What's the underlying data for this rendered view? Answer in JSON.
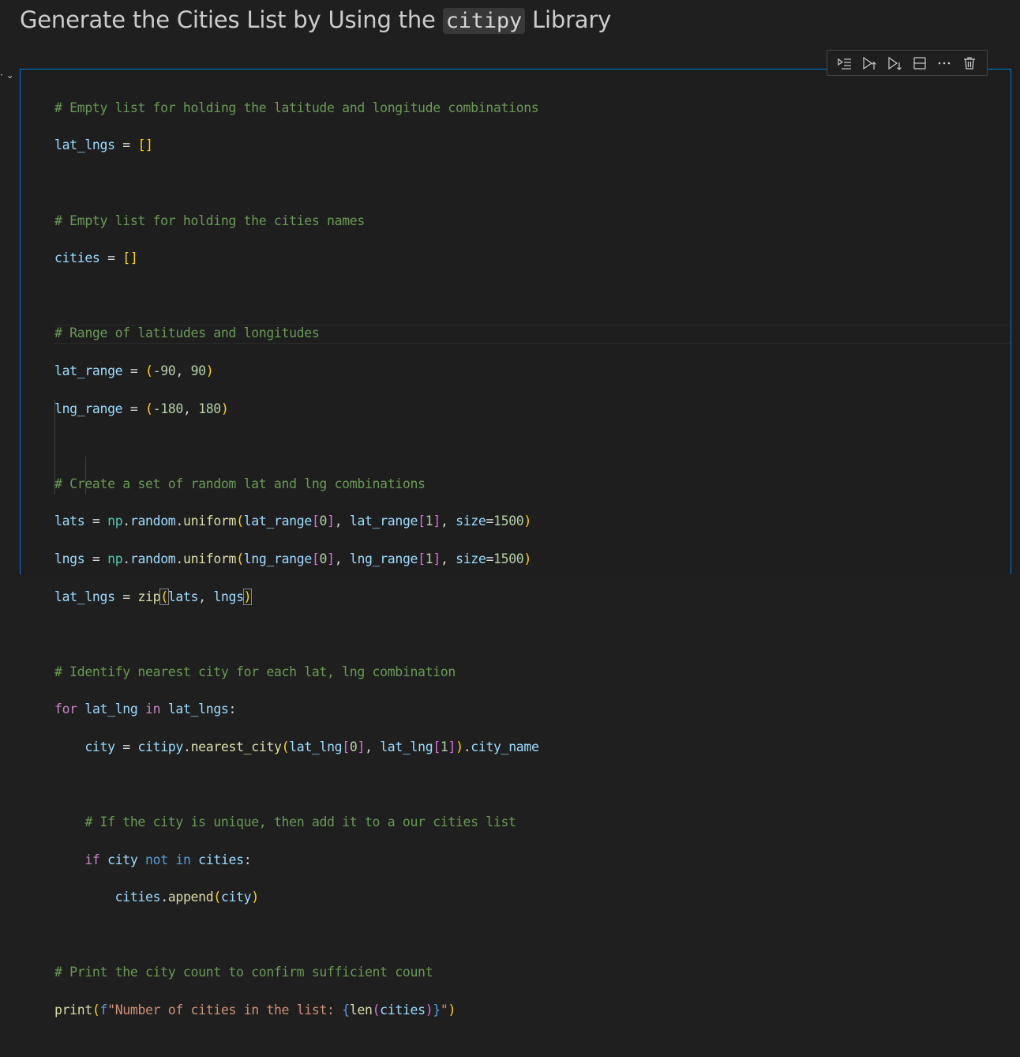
{
  "heading": {
    "prefix": "Generate the Cities List by Using the ",
    "code": "citipy",
    "suffix": " Library"
  },
  "toolbar": {
    "icons": [
      "run-by-line-icon",
      "run-above-icon",
      "run-below-icon",
      "split-cell-icon",
      "more-actions-icon",
      "delete-cell-icon"
    ]
  },
  "code": {
    "c1": "# Empty list for holding the latitude and longitude combinations",
    "c2": "# Empty list for holding the cities names",
    "c3": "# Range of latitudes and longitudes",
    "c4": "# Create a set of random lat and lng combinations",
    "c5": "# Identify nearest city for each lat, lng combination",
    "c6": "# If the city is unique, then add it to a our cities list",
    "c7": "# Print the city count to confirm sufficient count",
    "v_lat_lngs": "lat_lngs",
    "v_cities": "cities",
    "v_lat_range": "lat_range",
    "v_lng_range": "lng_range",
    "v_lats": "lats",
    "v_lngs": "lngs",
    "v_lat_lng": "lat_lng",
    "v_city": "city",
    "v_city_name": "city_name",
    "v_size": "size",
    "m_np": "np",
    "m_citipy": "citipy",
    "a_random": "random",
    "f_uniform": "uniform",
    "f_zip": "zip",
    "f_nearest_city": "nearest_city",
    "f_append": "append",
    "f_print": "print",
    "f_len": "len",
    "k_for": "for",
    "k_in": "in",
    "k_if": "if",
    "k_not": "not",
    "n_m90": "-90",
    "n_90": "90",
    "n_m180": "-180",
    "n_180": "180",
    "n_0": "0",
    "n_1": "1",
    "n_1500": "1500",
    "s_prefix": "f",
    "s_text": "\"Number of cities in the list: ",
    "s_end": "\""
  }
}
